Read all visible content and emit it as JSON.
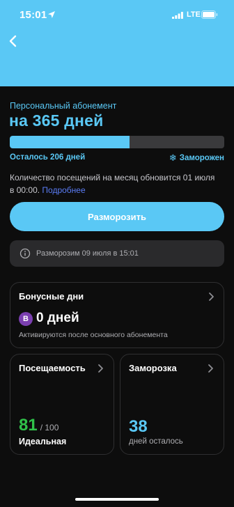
{
  "status_bar": {
    "time": "15:01",
    "network": "LTE"
  },
  "membership": {
    "subtitle": "Персональный абонемент",
    "title": "на 365 дней",
    "progress_percent": 56,
    "remaining": "Осталось 206 дней",
    "frozen_label": "Заморожен",
    "info_text": "Количество посещений на месяц обновится 01 июля в 00:00. ",
    "info_link": "Подробнее"
  },
  "unfreeze_button": "Разморозить",
  "notice": "Разморозим 09 июля в 15:01",
  "bonus": {
    "title": "Бонусные дни",
    "badge": "B",
    "value": "0 дней",
    "description": "Активируются после основного абонемента"
  },
  "attendance": {
    "title": "Посещаемость",
    "value": "81",
    "total": "/ 100",
    "label": "Идеальная"
  },
  "freeze": {
    "title": "Заморозка",
    "value": "38",
    "label": "дней осталось"
  },
  "colors": {
    "accent": "#5ac8f5",
    "good": "#30c24a",
    "bonus_badge": "#7b3fb0",
    "link": "#5a7cf5"
  }
}
